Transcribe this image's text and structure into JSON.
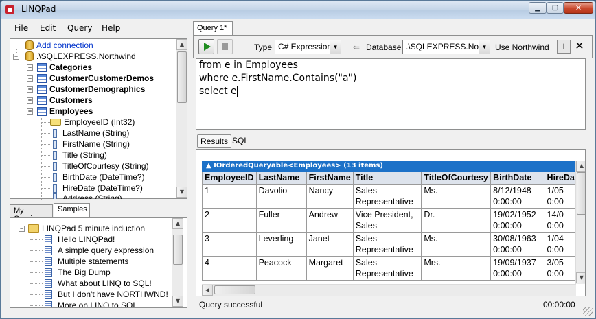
{
  "window": {
    "title": "LINQPad",
    "minimize": "▁",
    "maximize": "▢",
    "close": "✕"
  },
  "menu": [
    "File",
    "Edit",
    "Query",
    "Help"
  ],
  "schema_tree": {
    "add_connection": "Add connection",
    "connection": ".\\SQLEXPRESS.Northwind",
    "tables": [
      "Categories",
      "CustomerCustomerDemos",
      "CustomerDemographics",
      "Customers",
      "Employees"
    ],
    "columns": [
      {
        "label": "EmployeeID (Int32)",
        "key": true
      },
      {
        "label": "LastName (String)"
      },
      {
        "label": "FirstName (String)"
      },
      {
        "label": "Title (String)"
      },
      {
        "label": "TitleOfCourtesy (String)"
      },
      {
        "label": "BirthDate (DateTime?)"
      },
      {
        "label": "HireDate (DateTime?)"
      },
      {
        "label": "Address (String)"
      }
    ]
  },
  "bottom_tabs": [
    "My Queries",
    "Samples"
  ],
  "samples": {
    "folder": "LINQPad 5 minute induction",
    "items": [
      "Hello LINQPad!",
      "A simple query expression",
      "Multiple statements",
      "The Big Dump",
      "What about LINQ to SQL!",
      "But I don't have NORTHWND!",
      "More on LINQ to SQL"
    ]
  },
  "query": {
    "tab": "Query 1*",
    "type_label": "Type",
    "type_value": "C# Expression",
    "database_label": "Database",
    "database_value": ".\\SQLEXPRESS.Northwind",
    "use_label": "Use Northwind",
    "pin": "⊥",
    "close": "✕",
    "code": [
      "from e in Employees",
      "where e.FirstName.Contains(\"a\")",
      "select e"
    ]
  },
  "results": {
    "tabs": [
      "Results",
      "SQL"
    ],
    "header": "▲ IOrderedQueryable<Employees> (13 items)",
    "columns": [
      "EmployeeID",
      "LastName",
      "FirstName",
      "Title",
      "TitleOfCourtesy",
      "BirthDate",
      "HireDate"
    ],
    "rows": [
      {
        "EmployeeID": "1",
        "LastName": "Davolio",
        "FirstName": "Nancy",
        "Title": "Sales\nRepresentative",
        "TitleOfCourtesy": "Ms.",
        "BirthDate": "8/12/1948\n0:00:00",
        "HireDate": "1/05\n0:00"
      },
      {
        "EmployeeID": "2",
        "LastName": "Fuller",
        "FirstName": "Andrew",
        "Title": "Vice President,\nSales",
        "TitleOfCourtesy": "Dr.",
        "BirthDate": "19/02/1952\n0:00:00",
        "HireDate": "14/0\n0:00"
      },
      {
        "EmployeeID": "3",
        "LastName": "Leverling",
        "FirstName": "Janet",
        "Title": "Sales\nRepresentative",
        "TitleOfCourtesy": "Ms.",
        "BirthDate": "30/08/1963\n0:00:00",
        "HireDate": "1/04\n0:00"
      },
      {
        "EmployeeID": "4",
        "LastName": "Peacock",
        "FirstName": "Margaret",
        "Title": "Sales\nRepresentative",
        "TitleOfCourtesy": "Mrs.",
        "BirthDate": "19/09/1937\n0:00:00",
        "HireDate": "3/05\n0:00"
      }
    ]
  },
  "status": {
    "message": "Query successful",
    "time": "00:00:00"
  }
}
